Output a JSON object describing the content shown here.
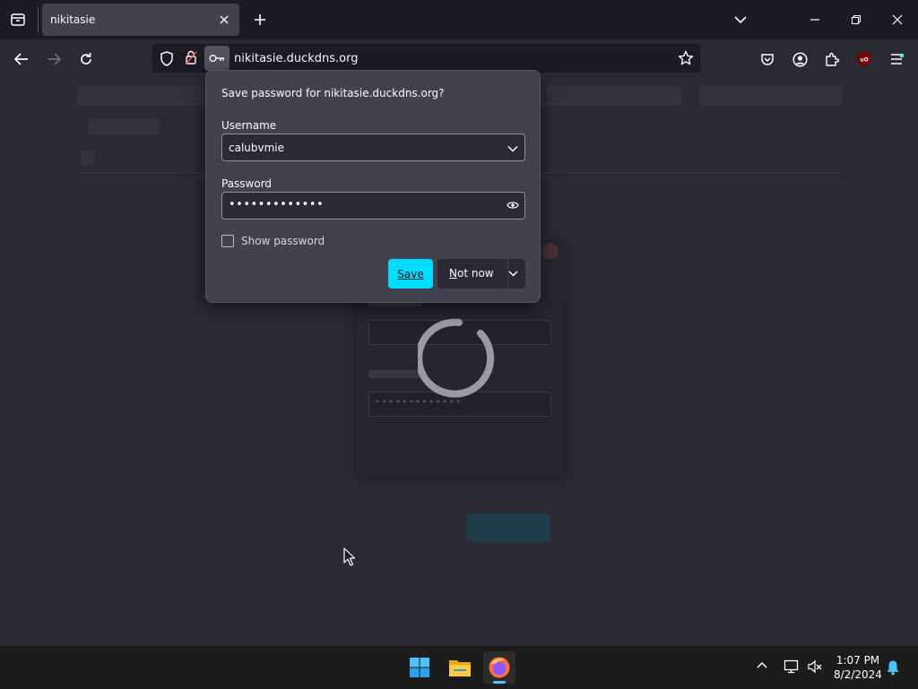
{
  "browser": {
    "tab": {
      "title": "nikitasie"
    },
    "url": "nikitasie.duckdns.org"
  },
  "dialog": {
    "title": "Save password for nikitasie.duckdns.org?",
    "username_label": "Username",
    "username_value": "calubvmie",
    "password_label": "Password",
    "password_value": "•••••••••••••",
    "show_password_label": "Show password",
    "show_password_checked": false,
    "save_label": "Save",
    "not_now_label": "Not now"
  },
  "page": {
    "login_form": {
      "password_mask": "•••••••••••••"
    }
  },
  "taskbar": {
    "apps": [
      "start-icon",
      "file-explorer-icon",
      "firefox-icon"
    ],
    "time": "1:07 PM",
    "date": "8/2/2024"
  },
  "colors": {
    "accent": "#00ddff",
    "dialog_bg": "#42414d",
    "page_bg": "#2b2a33",
    "toolbar_bg": "#1c1b22"
  }
}
